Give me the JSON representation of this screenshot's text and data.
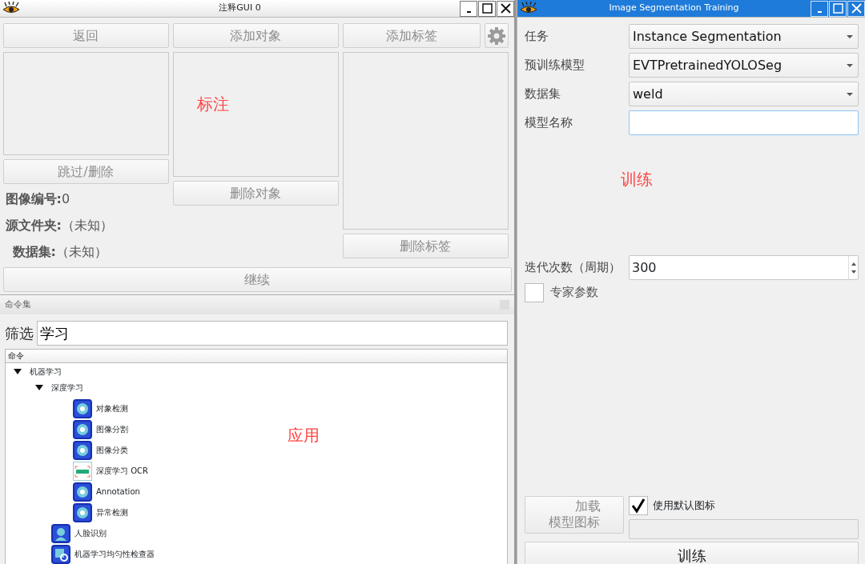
{
  "annotation_window": {
    "title": "注释GUI 0",
    "top_buttons": [
      {
        "label": "返回",
        "disabled": true
      },
      {
        "label": "添加对象",
        "disabled": true
      },
      {
        "label": "添加标签",
        "disabled": true
      }
    ],
    "settings_button": {
      "disabled": true
    },
    "skip_button": {
      "label": "跳过/删除",
      "disabled": true
    },
    "delete_object_button": {
      "label": "删除对象",
      "disabled": true
    },
    "delete_label_button": {
      "label": "删除标签",
      "disabled": true
    },
    "info": [
      {
        "label": "图像编号:",
        "value": "0"
      },
      {
        "label": "源文件夹:",
        "value": "（未知）"
      },
      {
        "label": "数据集:",
        "value": "（未知）"
      }
    ],
    "continue_button": {
      "label": "继续",
      "disabled": true
    },
    "overlay_note": "标注"
  },
  "command_panel": {
    "title": "命令集",
    "filter_label": "筛选",
    "filter_value": "学习",
    "column": "命令",
    "tree": [
      {
        "label": "机器学习",
        "expanded": true,
        "children": [
          {
            "label": "深度学习",
            "expanded": true,
            "children": [
              {
                "label": "对象检测",
                "kind": "tool"
              },
              {
                "label": "图像分割",
                "kind": "tool"
              },
              {
                "label": "图像分类",
                "kind": "tool"
              },
              {
                "label": "深度学习 OCR",
                "kind": "ocr"
              },
              {
                "label": "Annotation",
                "kind": "tool"
              },
              {
                "label": "异常检测",
                "kind": "tool"
              }
            ]
          },
          {
            "label": "人脸识别",
            "kind": "face"
          },
          {
            "label": "机器学习均匀性检查器",
            "kind": "grid"
          }
        ]
      }
    ],
    "overlay_note": "应用"
  },
  "training_window": {
    "title": "Image Segmentation Training",
    "fields": [
      {
        "label": "任务",
        "kind": "combo",
        "value": "Instance Segmentation"
      },
      {
        "label": "预训练模型",
        "kind": "combo",
        "value": "EVTPretrainedYOLOSeg"
      },
      {
        "label": "数据集",
        "kind": "combo",
        "value": "weld"
      },
      {
        "label": "模型名称",
        "kind": "text"
      }
    ],
    "overlay_note": "训练",
    "epochs": {
      "label": "迭代次数（周期）",
      "value": "300"
    },
    "expert_params": {
      "label": "专家参数",
      "checked": false
    },
    "load_icon_button": {
      "label": "加载模型图标",
      "disabled": true
    },
    "default_icon": {
      "label": "使用默认图标",
      "checked": true
    },
    "train_button": {
      "label": "训练",
      "disabled": false
    }
  }
}
